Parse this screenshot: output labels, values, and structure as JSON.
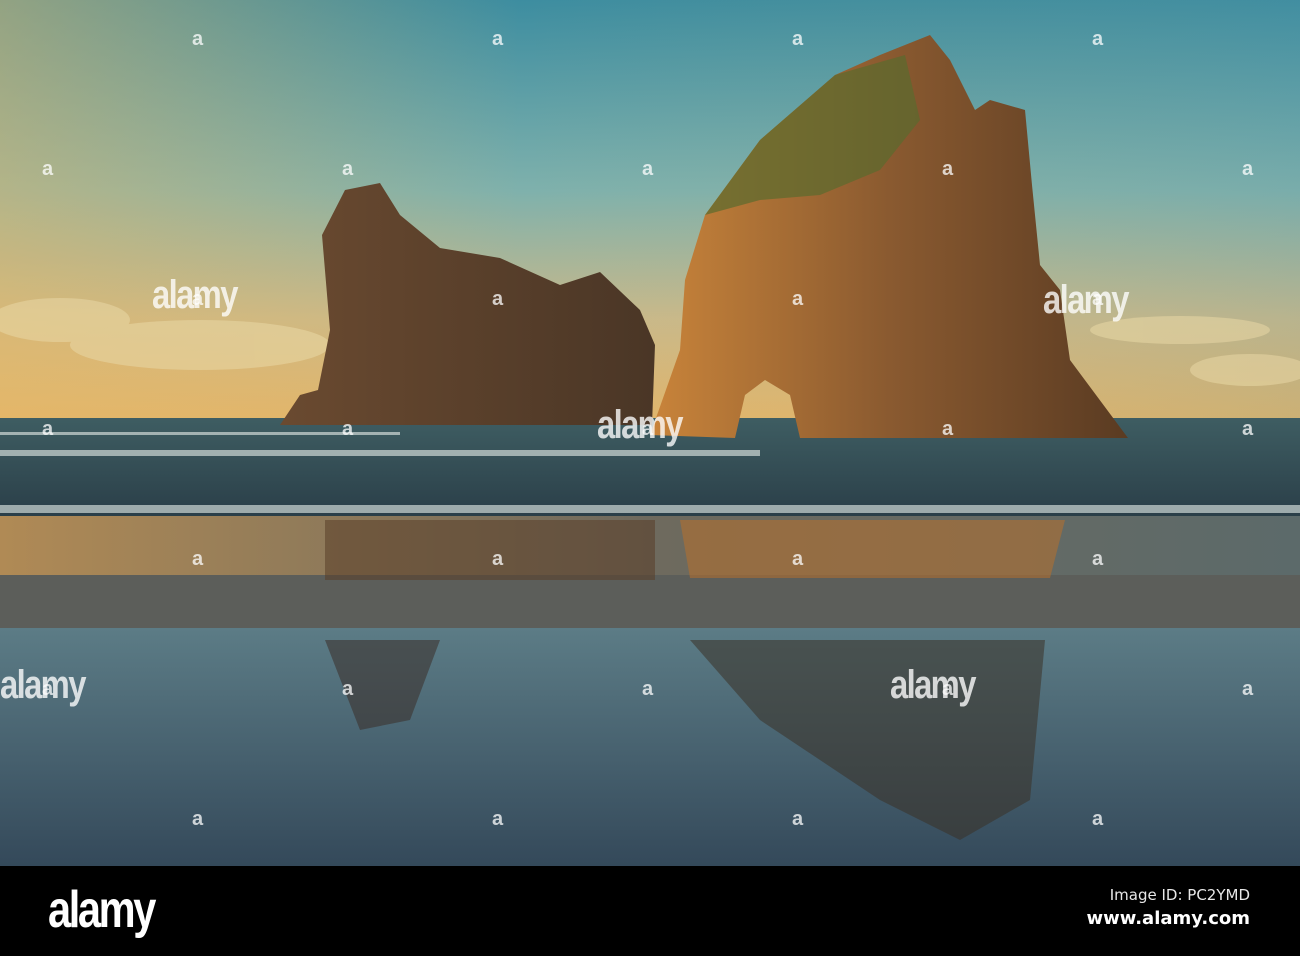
{
  "watermark": {
    "text": "alamy",
    "mark": "a"
  },
  "footer": {
    "logo": "alamy",
    "image_id": "Image ID: PC2YMD",
    "website": "www.alamy.com"
  }
}
